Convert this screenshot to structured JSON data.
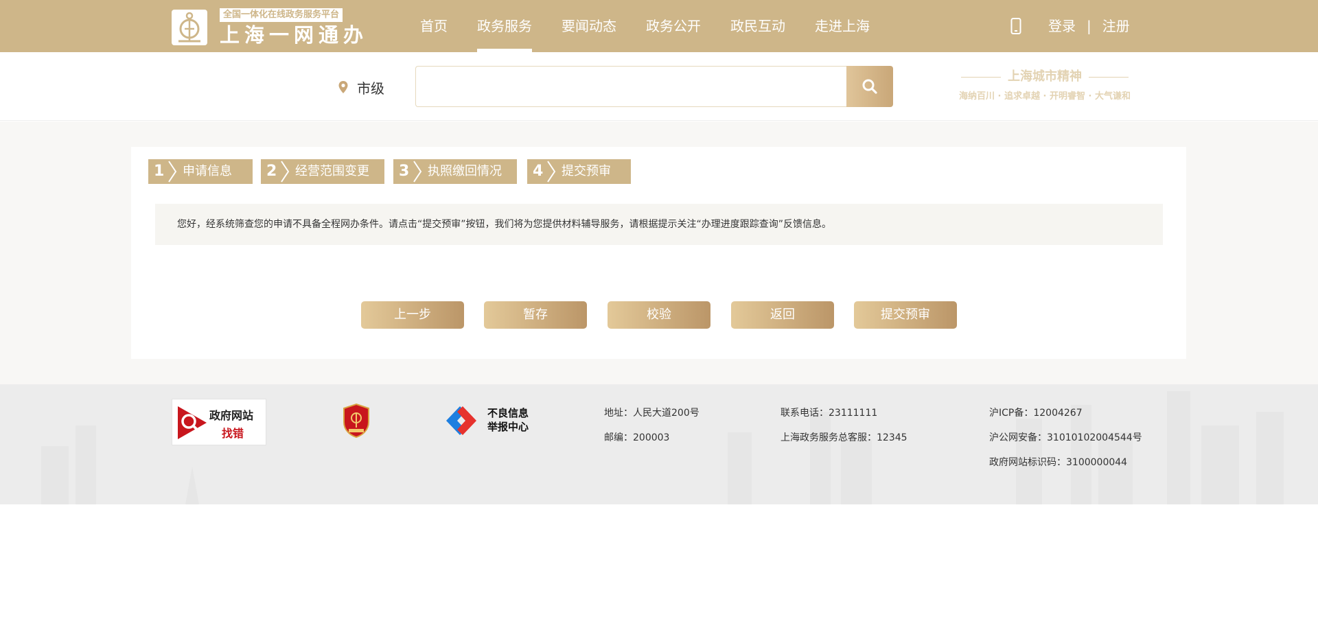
{
  "header": {
    "logo_subtitle": "全国一体化在线政务服务平台",
    "logo_title": "上海一网通办",
    "nav": [
      {
        "label": "首页",
        "active": false
      },
      {
        "label": "政务服务",
        "active": true
      },
      {
        "label": "要闻动态",
        "active": false
      },
      {
        "label": "政务公开",
        "active": false
      },
      {
        "label": "政民互动",
        "active": false
      },
      {
        "label": "走进上海",
        "active": false
      }
    ],
    "login_label": "登录",
    "separator": "|",
    "register_label": "注册"
  },
  "search": {
    "location_label": "市级",
    "value": "",
    "placeholder": ""
  },
  "spirit": {
    "title": "上海城市精神",
    "subtitle": "海纳百川 · 追求卓越 · 开明睿智 · 大气谦和"
  },
  "steps": [
    {
      "number": "1",
      "label": "申请信息"
    },
    {
      "number": "2",
      "label": "经营范围变更"
    },
    {
      "number": "3",
      "label": "执照缴回情况"
    },
    {
      "number": "4",
      "label": "提交预审"
    }
  ],
  "notice": "您好，经系统筛查您的申请不具备全程网办条件。请点击“提交预审”按钮，我们将为您提供材料辅导服务，请根据提示关注“办理进度跟踪查询”反馈信息。",
  "actions": {
    "prev": "上一步",
    "save": "暂存",
    "validate": "校验",
    "back": "返回",
    "submit": "提交预审"
  },
  "footer": {
    "badge_gov_top": "政府网站",
    "badge_gov_bottom": "找错",
    "badge_report_line1": "不良信息",
    "badge_report_line2": "举报中心",
    "address": "地址：人民大道200号",
    "postcode": "邮编：200003",
    "phone": "联系电话：23111111",
    "hotline": "上海政务服务总客服：12345",
    "icp": "沪ICP备：12004267",
    "police_record": "沪公网安备：31010102004544号",
    "site_code": "政府网站标识码：3100000044"
  },
  "colors": {
    "brand": "#ceb689",
    "button_gradient_start": "#e3c999",
    "button_gradient_end": "#bb9668",
    "notice_bg": "#f6f5f1",
    "report_red": "#c8161d"
  }
}
